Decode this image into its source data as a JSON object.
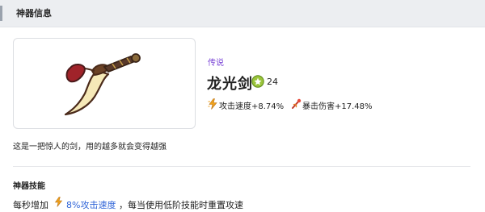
{
  "header": {
    "title": "神器信息"
  },
  "artifact": {
    "rarity": "传说",
    "name": "龙光剑",
    "level": "24",
    "stats": [
      {
        "icon": "speed-bolt-icon",
        "label": "攻击速度+8.74%"
      },
      {
        "icon": "crit-damage-icon",
        "label": "暴击伤害+17.48%"
      }
    ],
    "description": "这是一把惊人的剑，用的越多就会变得越强"
  },
  "skills": {
    "title": "神器技能",
    "prefix": "每秒增加",
    "highlight": "8%攻击速度",
    "suffix": "，每当使用低阶技能时重置攻速"
  },
  "colors": {
    "rarity": "#7a45d6",
    "highlight": "#2f64d8",
    "header_bg": "#eceef1"
  }
}
